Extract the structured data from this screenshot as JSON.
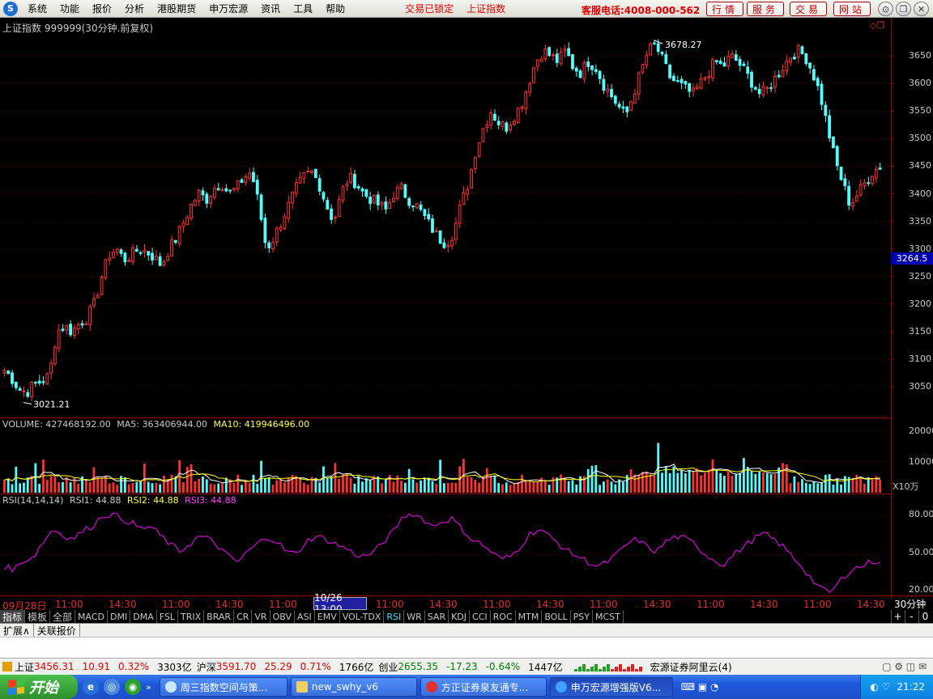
{
  "menu": {
    "items": [
      "系统",
      "功能",
      "报价",
      "分析",
      "港股期货",
      "申万宏源",
      "资讯",
      "工具",
      "帮助"
    ],
    "status_locked": "交易已锁定",
    "status_index": "上证指数",
    "hotline": "客服电话:4008-000-562",
    "buttons": [
      "行情",
      "服务",
      "交易",
      "网站"
    ]
  },
  "chart": {
    "title": "上证指数 999999(30分钟.前复权)",
    "current_price": "3264.5",
    "high_label": "3678.27",
    "low_label": "3021.21",
    "price_ticks": [
      "3650",
      "3600",
      "3550",
      "3500",
      "3450",
      "3400",
      "3350",
      "3300",
      "3250",
      "3200",
      "3150",
      "3100",
      "3050"
    ],
    "volume": {
      "label": "VOLUME: 427468192.00",
      "ma5": "MA5: 363406944.00",
      "ma10": "MA10: 419946496.00",
      "ticks": [
        "20000",
        "10000"
      ],
      "unit": "X10万"
    },
    "rsi": {
      "label": "RSI(14,14,14)",
      "rsi1": "RSI1: 44.88",
      "rsi2": "RSI2: 44.88",
      "rsi3": "RSI3: 44.88",
      "ticks": [
        "80.00",
        "50.00",
        "20.00"
      ]
    },
    "time_labels": [
      "09月28日",
      "11:00",
      "14:30",
      "11:00",
      "14:30",
      "11:00",
      "10/26 13:00",
      "11:00",
      "14:30",
      "11:00",
      "14:30",
      "11:00",
      "14:30",
      "11:00",
      "14:30",
      "11:00",
      "14:30"
    ],
    "period": "30分钟"
  },
  "chart_data": {
    "type": "candlestick",
    "title": "上证指数 999999(30分钟.前复权)",
    "high": 3678.27,
    "low": 3021.21,
    "last": 3264.5,
    "ylim": [
      3000,
      3690
    ],
    "closes": [
      3080,
      3065,
      3045,
      3040,
      3055,
      3060,
      3070,
      3150,
      3160,
      3150,
      3165,
      3175,
      3200,
      3250,
      3290,
      3300,
      3280,
      3290,
      3300,
      3295,
      3285,
      3270,
      3300,
      3320,
      3350,
      3380,
      3400,
      3390,
      3410,
      3420,
      3400,
      3410,
      3430,
      3440,
      3380,
      3300,
      3320,
      3350,
      3380,
      3410,
      3430,
      3440,
      3420,
      3380,
      3350,
      3400,
      3430,
      3420,
      3400,
      3390,
      3380,
      3370,
      3400,
      3410,
      3390,
      3380,
      3360,
      3340,
      3320,
      3310,
      3330,
      3380,
      3420,
      3480,
      3520,
      3550,
      3530,
      3520,
      3540,
      3560,
      3600,
      3640,
      3660,
      3650,
      3640,
      3660,
      3630,
      3620,
      3640,
      3630,
      3600,
      3580,
      3560,
      3540,
      3580,
      3620,
      3660,
      3670,
      3640,
      3610,
      3600,
      3590,
      3580,
      3600,
      3620,
      3640,
      3630,
      3650,
      3640,
      3620,
      3600,
      3580,
      3590,
      3610,
      3630,
      3650,
      3660,
      3650,
      3620,
      3580,
      3520,
      3460,
      3420,
      3380,
      3400,
      3420,
      3440,
      3450
    ],
    "volume_ticks": [
      20000,
      10000
    ],
    "volume_unit": "X10万",
    "volume": 427468192.0,
    "ma5": 363406944.0,
    "ma10": 419946496.0,
    "rsi_ticks": [
      80,
      50,
      20
    ],
    "rsi": [
      40,
      38,
      45,
      48,
      60,
      70,
      65,
      62,
      68,
      72,
      80,
      82,
      78,
      75,
      70,
      72,
      65,
      58,
      52,
      58,
      64,
      62,
      56,
      48,
      44,
      52,
      58,
      64,
      60,
      52,
      50,
      60,
      64,
      62,
      58,
      55,
      50,
      48,
      52,
      60,
      68,
      80,
      82,
      78,
      72,
      76,
      78,
      70,
      62,
      58,
      52,
      46,
      48,
      56,
      66,
      70,
      64,
      58,
      52,
      48,
      44,
      40,
      44,
      50,
      58,
      62,
      56,
      52,
      60,
      64,
      62,
      58,
      50,
      45,
      42,
      50,
      56,
      62,
      66,
      62,
      56,
      48,
      40,
      30,
      22,
      20,
      30,
      38,
      40,
      44,
      45
    ],
    "rsi1": 44.88,
    "rsi2": 44.88,
    "rsi3": 44.88
  },
  "tabs": [
    "指标",
    "模板",
    "全部",
    "MACD",
    "DMI",
    "DMA",
    "FSL",
    "TRIX",
    "BRAR",
    "CR",
    "VR",
    "OBV",
    "ASI",
    "EMV",
    "VOL-TDX",
    "RSI",
    "WR",
    "SAR",
    "KDJ",
    "CCI",
    "ROC",
    "MTM",
    "BOLL",
    "PSY",
    "MCST"
  ],
  "tab_controls": [
    "+",
    "-",
    "0"
  ],
  "ext_tabs": [
    "扩展∧",
    "关联报价"
  ],
  "status": {
    "sh_label": "上证",
    "sh_price": "3456.31",
    "sh_change": "10.91",
    "sh_pct": "0.32%",
    "sh_amount": "3303亿",
    "hs_label": "沪深",
    "hs_price": "3591.70",
    "hs_change": "25.29",
    "hs_pct": "0.71%",
    "hs_amount": "1766亿",
    "cy_label": "创业",
    "cy_price": "2655.35",
    "cy_change": "-17.23",
    "cy_pct": "-0.64%",
    "cy_amount": "1447亿",
    "server": "宏源证券阿里云(4)"
  },
  "taskbar": {
    "start": "开始",
    "tasks": [
      "周三指数空间与策...",
      "new_swhy_v6",
      "方正证券泉友通专...",
      "申万宏源增强版V6..."
    ],
    "clock": "21:22"
  },
  "colors": {
    "up": "#ff3232",
    "down": "#54fcfc",
    "ma5": "#ffffff",
    "ma10": "#ffff00",
    "rsi": "#ff00ff"
  }
}
